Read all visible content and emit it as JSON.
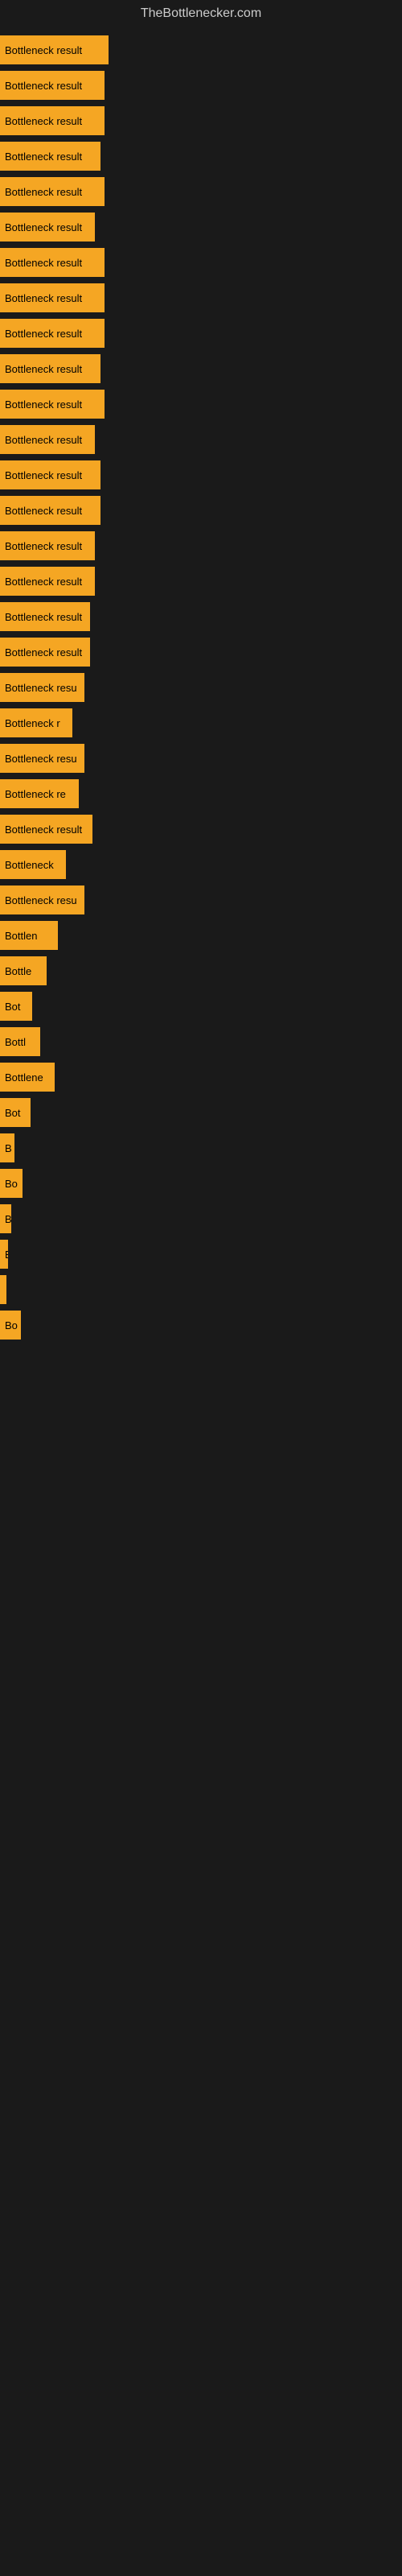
{
  "site": {
    "title": "TheBottlenecker.com"
  },
  "bars": [
    {
      "label": "Bottleneck result",
      "width": 135
    },
    {
      "label": "Bottleneck result",
      "width": 130
    },
    {
      "label": "Bottleneck result",
      "width": 130
    },
    {
      "label": "Bottleneck result",
      "width": 125
    },
    {
      "label": "Bottleneck result",
      "width": 130
    },
    {
      "label": "Bottleneck result",
      "width": 118
    },
    {
      "label": "Bottleneck result",
      "width": 130
    },
    {
      "label": "Bottleneck result",
      "width": 130
    },
    {
      "label": "Bottleneck result",
      "width": 130
    },
    {
      "label": "Bottleneck result",
      "width": 125
    },
    {
      "label": "Bottleneck result",
      "width": 130
    },
    {
      "label": "Bottleneck result",
      "width": 118
    },
    {
      "label": "Bottleneck result",
      "width": 125
    },
    {
      "label": "Bottleneck result",
      "width": 125
    },
    {
      "label": "Bottleneck result",
      "width": 118
    },
    {
      "label": "Bottleneck result",
      "width": 118
    },
    {
      "label": "Bottleneck result",
      "width": 112
    },
    {
      "label": "Bottleneck result",
      "width": 112
    },
    {
      "label": "Bottleneck resu",
      "width": 105
    },
    {
      "label": "Bottleneck r",
      "width": 90
    },
    {
      "label": "Bottleneck resu",
      "width": 105
    },
    {
      "label": "Bottleneck re",
      "width": 98
    },
    {
      "label": "Bottleneck result",
      "width": 115
    },
    {
      "label": "Bottleneck",
      "width": 82
    },
    {
      "label": "Bottleneck resu",
      "width": 105
    },
    {
      "label": "Bottlen",
      "width": 72
    },
    {
      "label": "Bottle",
      "width": 58
    },
    {
      "label": "Bot",
      "width": 40
    },
    {
      "label": "Bottl",
      "width": 50
    },
    {
      "label": "Bottlene",
      "width": 68
    },
    {
      "label": "Bot",
      "width": 38
    },
    {
      "label": "B",
      "width": 18
    },
    {
      "label": "Bo",
      "width": 28
    },
    {
      "label": "B",
      "width": 14
    },
    {
      "label": "B",
      "width": 10
    },
    {
      "label": "",
      "width": 8
    },
    {
      "label": "Bo",
      "width": 26
    }
  ]
}
